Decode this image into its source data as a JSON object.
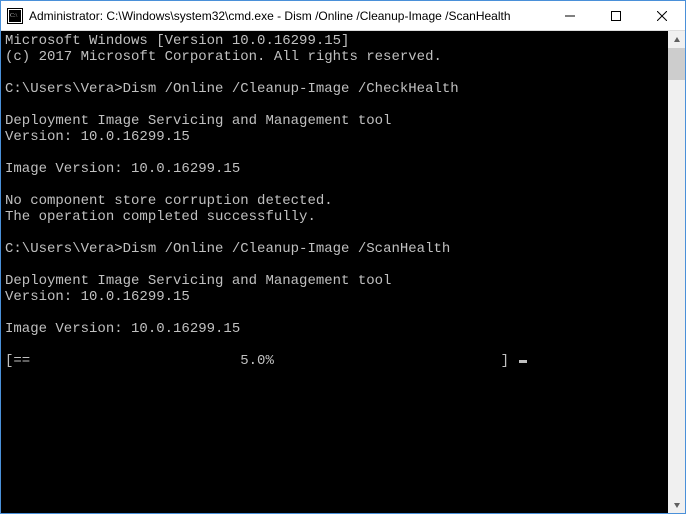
{
  "window": {
    "title": "Administrator: C:\\Windows\\system32\\cmd.exe - Dism  /Online /Cleanup-Image /ScanHealth"
  },
  "console": {
    "header1": "Microsoft Windows [Version 10.0.16299.15]",
    "header2": "(c) 2017 Microsoft Corporation. All rights reserved.",
    "blank": "",
    "prompt1": "C:\\Users\\Vera>",
    "cmd1": "Dism /Online /Cleanup-Image /CheckHealth",
    "tool_line": "Deployment Image Servicing and Management tool",
    "version_line": "Version: 10.0.16299.15",
    "image_version_line": "Image Version: 10.0.16299.15",
    "result1a": "No component store corruption detected.",
    "result1b": "The operation completed successfully.",
    "prompt2": "C:\\Users\\Vera>",
    "cmd2": "Dism /Online /Cleanup-Image /ScanHealth",
    "progress_line": "[==                         5.0%                           ] "
  }
}
